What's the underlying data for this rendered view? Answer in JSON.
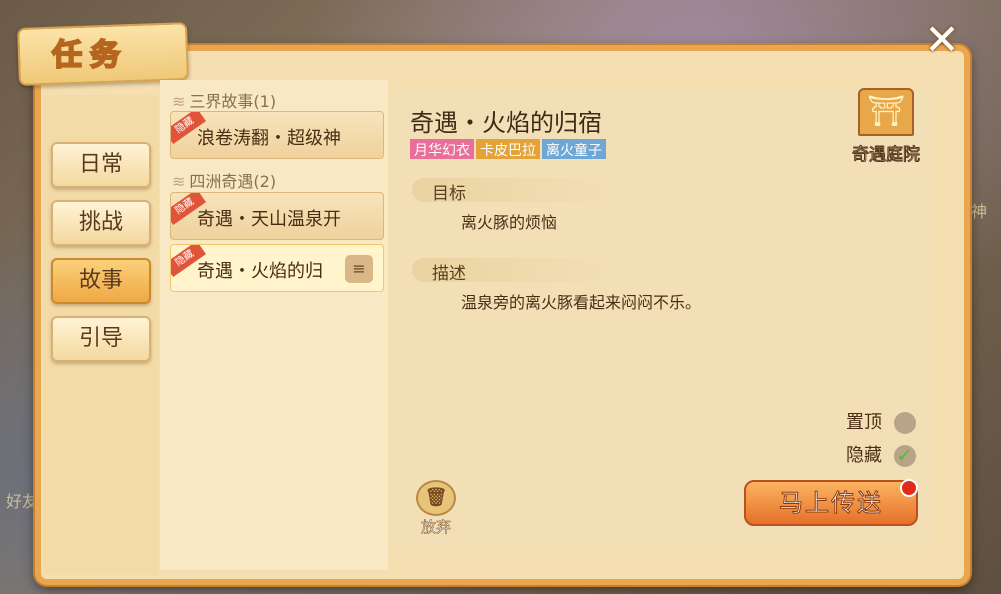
{
  "window": {
    "title": "任务",
    "close_glyph": "✕"
  },
  "sidebar": {
    "items": [
      {
        "label": "日常",
        "active": false
      },
      {
        "label": "挑战",
        "active": false
      },
      {
        "label": "故事",
        "active": true
      },
      {
        "label": "引导",
        "active": false
      }
    ]
  },
  "quest_list": {
    "groups": [
      {
        "label": "三界故事(1)",
        "items": [
          {
            "label": "浪卷涛翻・超级神",
            "badge": "隐藏",
            "selected": false
          }
        ]
      },
      {
        "label": "四洲奇遇(2)",
        "items": [
          {
            "label": "奇遇・天山温泉开",
            "badge": "隐藏",
            "selected": false
          },
          {
            "label": "奇遇・火焰的归",
            "badge": "隐藏",
            "selected": true
          }
        ]
      }
    ]
  },
  "detail": {
    "title": "奇遇・火焰的归宿",
    "tags": [
      {
        "label": "月华幻衣",
        "color": "#e86f9a"
      },
      {
        "label": "卡皮巴拉",
        "color": "#e4a23a"
      },
      {
        "label": "离火童子",
        "color": "#6fa7d4"
      }
    ],
    "goal_label": "目标",
    "goal_text": "离火豚的烦恼",
    "desc_label": "描述",
    "desc_text": "温泉旁的离火豚看起来闷闷不乐。",
    "pavilion_label": "奇遇庭院",
    "pin_label": "置顶",
    "hide_label": "隐藏",
    "abandon_label": "放弃",
    "teleport_label": "马上传送"
  },
  "background": {
    "text_left": "好友",
    "text_right": "武神"
  },
  "colors": {
    "accent": "#e9a650",
    "button": "#e5702a",
    "check": "#5ab83a"
  }
}
